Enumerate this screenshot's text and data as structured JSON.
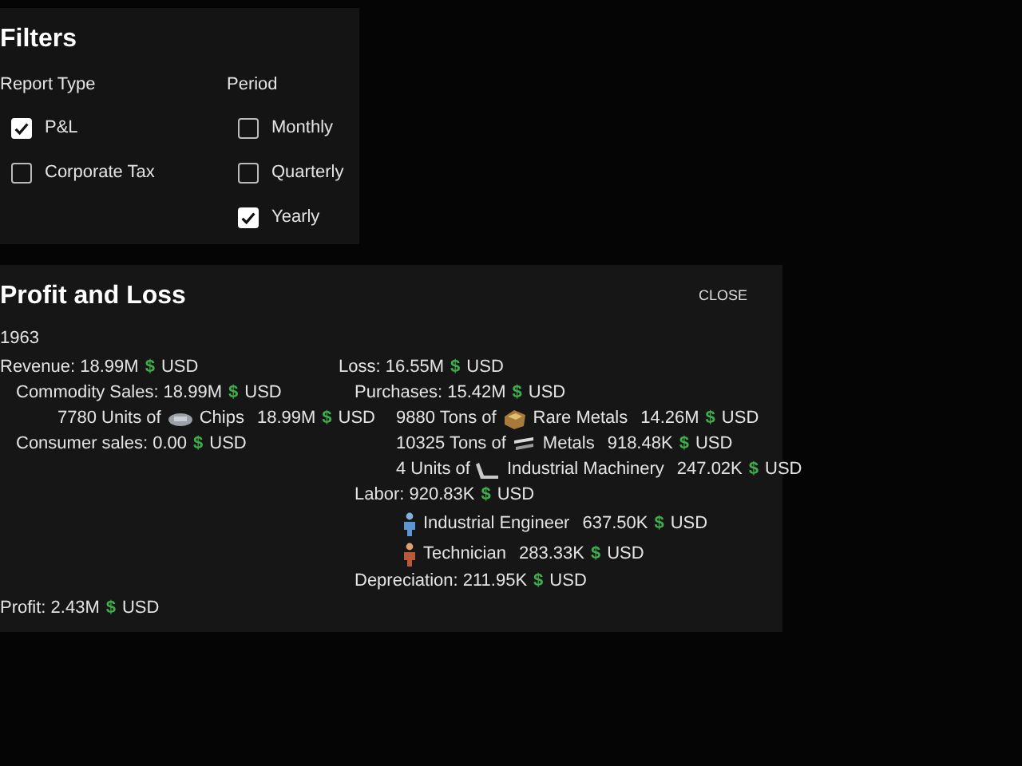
{
  "filters": {
    "title": "Filters",
    "groups": [
      {
        "label": "Report Type",
        "options": [
          {
            "label": "P&L",
            "checked": true
          },
          {
            "label": "Corporate Tax",
            "checked": false
          }
        ]
      },
      {
        "label": "Period",
        "options": [
          {
            "label": "Monthly",
            "checked": false
          },
          {
            "label": "Quarterly",
            "checked": false
          },
          {
            "label": "Yearly",
            "checked": true
          }
        ]
      }
    ]
  },
  "report": {
    "title": "Profit and Loss",
    "close": "CLOSE",
    "year": "1963",
    "columns": [
      {
        "lines": [
          {
            "kind": "total",
            "label": "Revenue: 18.99M",
            "sign": "$",
            "unit": "USD",
            "children": [
              {
                "kind": "total",
                "label": "Commodity Sales: 18.99M",
                "sign": "$",
                "unit": "USD",
                "children": [
                  {
                    "kind": "item",
                    "prefix": "7780 Units of",
                    "name": "Chips",
                    "amount": "18.99M",
                    "sign": "$",
                    "unit": "USD"
                  }
                ]
              },
              {
                "kind": "total",
                "label": "Consumer sales: 0.00",
                "sign": "$",
                "unit": "USD"
              }
            ]
          }
        ]
      },
      {
        "lines": [
          {
            "kind": "total",
            "label": "Loss: 16.55M",
            "sign": "$",
            "unit": "USD",
            "children": [
              {
                "kind": "total",
                "label": "Purchases: 15.42M",
                "sign": "$",
                "unit": "USD",
                "children": [
                  {
                    "kind": "item",
                    "prefix": "9880 Tons of",
                    "name": "Rare Metals",
                    "amount": "14.26M",
                    "sign": "$",
                    "unit": "USD"
                  },
                  {
                    "kind": "item",
                    "prefix": "10325 Tons of",
                    "name": "Metals",
                    "amount": "918.48K",
                    "sign": "$",
                    "unit": "USD"
                  },
                  {
                    "kind": "item",
                    "prefix": "4 Units of",
                    "name": "Industrial Machinery",
                    "amount": "247.02K",
                    "sign": "$",
                    "unit": "USD"
                  }
                ]
              },
              {
                "kind": "total",
                "label": "Labor: 920.83K",
                "sign": "$",
                "unit": "USD",
                "children": [
                  {
                    "kind": "worker",
                    "name": "Industrial Engineer",
                    "amount": "637.50K",
                    "sign": "$",
                    "unit": "USD"
                  },
                  {
                    "kind": "worker",
                    "name": "Technician",
                    "amount": "283.33K",
                    "sign": "$",
                    "unit": "USD"
                  }
                ]
              },
              {
                "kind": "total",
                "label": "Depreciation: 211.95K",
                "sign": "$",
                "unit": "USD"
              }
            ]
          }
        ]
      }
    ],
    "profit": {
      "label": "Profit: 2.43M",
      "sign": "$",
      "unit": "USD"
    }
  }
}
